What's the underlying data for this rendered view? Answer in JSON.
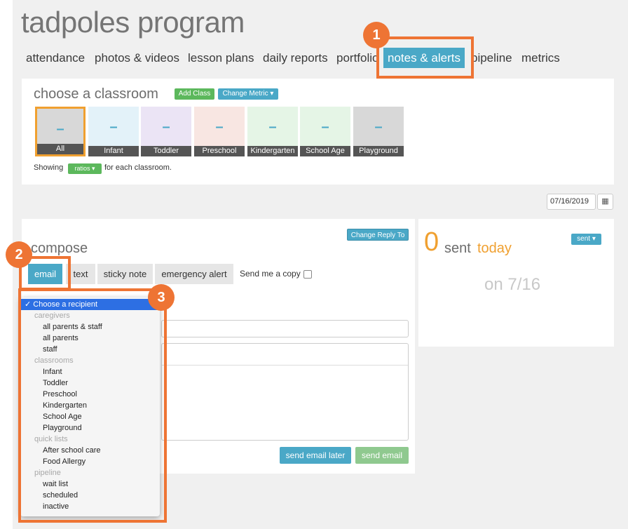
{
  "app": {
    "title": "tadpoles program"
  },
  "nav": {
    "items": [
      {
        "label": "attendance"
      },
      {
        "label": "photos & videos"
      },
      {
        "label": "lesson plans"
      },
      {
        "label": "daily reports"
      },
      {
        "label": "portfolio"
      },
      {
        "label": "notes & alerts"
      },
      {
        "label": "pipeline"
      },
      {
        "label": "metrics"
      }
    ]
  },
  "badges": [
    "1",
    "2",
    "3"
  ],
  "classroom": {
    "heading": "choose a classroom",
    "add_class": "Add Class",
    "change_metric": "Change Metric",
    "tiles": [
      {
        "label": "All",
        "value": "–"
      },
      {
        "label": "Infant",
        "value": "–"
      },
      {
        "label": "Toddler",
        "value": "–"
      },
      {
        "label": "Preschool",
        "value": "–"
      },
      {
        "label": "Kindergarten",
        "value": "–"
      },
      {
        "label": "School Age",
        "value": "–"
      },
      {
        "label": "Playground",
        "value": "–"
      }
    ],
    "showing_prefix": "Showing",
    "showing_metric": "ratios",
    "showing_suffix": "for each classroom."
  },
  "date_picker": {
    "value": "07/16/2019"
  },
  "compose": {
    "heading": "compose",
    "change_reply_to": "Change Reply To",
    "tabs": [
      {
        "label": "email"
      },
      {
        "label": "text"
      },
      {
        "label": "sticky note"
      },
      {
        "label": "emergency alert"
      }
    ],
    "send_copy_label": "Send me a copy",
    "send_later": "send email later",
    "send_now": "send email"
  },
  "sent_panel": {
    "count": "0",
    "sent_label": "sent",
    "today_label": "today",
    "filter": "sent",
    "on_date": "on 7/16"
  },
  "recipient_menu": {
    "selected": "Choose a recipient",
    "items": [
      {
        "type": "header",
        "label": "caregivers"
      },
      {
        "type": "option",
        "label": "all parents & staff"
      },
      {
        "type": "option",
        "label": "all parents"
      },
      {
        "type": "option",
        "label": "staff"
      },
      {
        "type": "header",
        "label": "classrooms"
      },
      {
        "type": "option",
        "label": "Infant"
      },
      {
        "type": "option",
        "label": "Toddler"
      },
      {
        "type": "option",
        "label": "Preschool"
      },
      {
        "type": "option",
        "label": "Kindergarten"
      },
      {
        "type": "option",
        "label": "School Age"
      },
      {
        "type": "option",
        "label": "Playground"
      },
      {
        "type": "header",
        "label": "quick lists"
      },
      {
        "type": "option",
        "label": "After school care"
      },
      {
        "type": "option",
        "label": "Food Allergy"
      },
      {
        "type": "header",
        "label": "pipeline"
      },
      {
        "type": "option",
        "label": "wait list"
      },
      {
        "type": "option",
        "label": "scheduled"
      },
      {
        "type": "option",
        "label": "inactive"
      }
    ]
  },
  "colors": {
    "accent_blue": "#4aa8c7",
    "accent_green": "#5cb85c",
    "highlight_orange": "#ee7434",
    "today_orange": "#f0a030"
  }
}
